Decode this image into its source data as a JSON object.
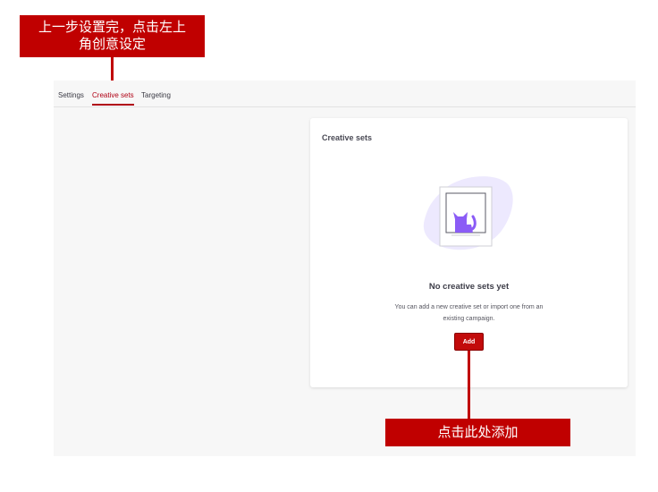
{
  "annotations": {
    "top_line1": "上一步设置完，点击左上",
    "top_line2": "角创意设定",
    "bottom": "点击此处添加"
  },
  "tabs": [
    {
      "label": "Settings",
      "active": false
    },
    {
      "label": "Creative sets",
      "active": true
    },
    {
      "label": "Targeting",
      "active": false
    }
  ],
  "card": {
    "title": "Creative sets",
    "empty_title": "No creative sets yet",
    "empty_desc_line1": "You can add a new creative set or import one from an",
    "empty_desc_line2": "existing campaign.",
    "add_label": "Add"
  },
  "colors": {
    "accent": "#b00014",
    "callout": "#c00000",
    "cat": "#8b5cf6",
    "blob": "#ede9fe"
  },
  "icons": [
    "cat-illustration-icon"
  ]
}
